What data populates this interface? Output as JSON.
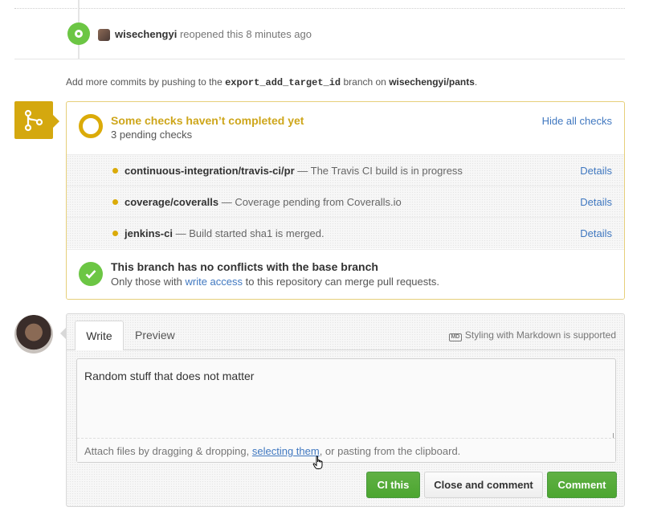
{
  "timeline_event": {
    "user": "wisechengyi",
    "action": "reopened this 8 minutes ago"
  },
  "push_hint": {
    "prefix": "Add more commits by pushing to the",
    "branch": "export_add_target_id",
    "middle": "branch on",
    "repo": "wisechengyi/pants",
    "suffix": "."
  },
  "merge_status": {
    "title": "Some checks haven’t completed yet",
    "subtitle": "3 pending checks",
    "hide_label": "Hide all checks",
    "checks": [
      {
        "name": "continuous-integration/travis-ci/pr",
        "description": "— The Travis CI build is in progress",
        "details": "Details"
      },
      {
        "name": "coverage/coveralls",
        "description": "— Coverage pending from Coveralls.io",
        "details": "Details"
      },
      {
        "name": "jenkins-ci",
        "description": "— Build started sha1 is merged.",
        "details": "Details"
      }
    ],
    "conflict_title": "This branch has no conflicts with the base branch",
    "conflict_prefix": "Only those with",
    "conflict_link": "write access",
    "conflict_suffix": "to this repository can merge pull requests.",
    "pending_color": "#dbab09",
    "success_color": "#6cc644"
  },
  "comment_form": {
    "tabs": [
      {
        "label": "Write"
      },
      {
        "label": "Preview"
      }
    ],
    "markdown_icon": "MD",
    "markdown_hint": "Styling with Markdown is supported",
    "textarea_value": "Random stuff that does not matter",
    "attach_prefix": "Attach files by dragging & dropping,",
    "attach_link": "selecting them",
    "attach_suffix": ", or pasting from the clipboard.",
    "buttons": {
      "ci": "CI this",
      "close": "Close and comment",
      "comment": "Comment"
    }
  }
}
